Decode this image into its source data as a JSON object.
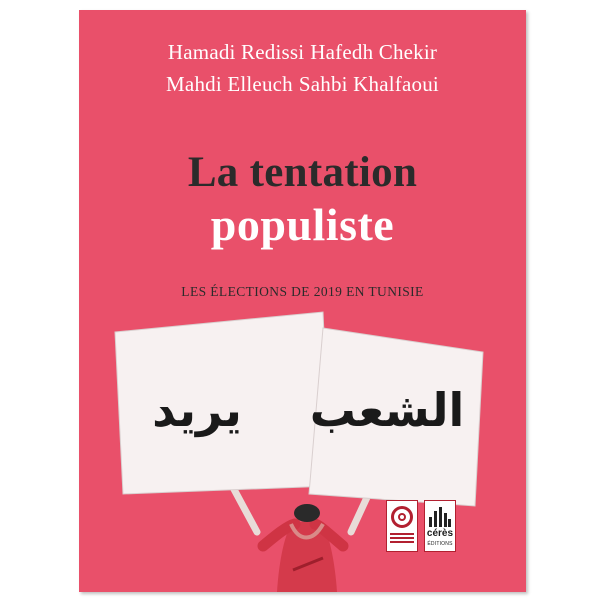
{
  "book": {
    "authors_line_1": [
      "Hamadi Redissi",
      "Hafedh Chekir"
    ],
    "authors_line_2": [
      "Mahdi Elleuch",
      "Sahbi Khalfaoui"
    ],
    "title_line_1": "La tentation",
    "title_line_2": "populiste",
    "subtitle": "LES ÉLECTIONS DE 2019 EN TUNISIE",
    "placard_left_text": "يريد",
    "placard_right_text": "الشعب",
    "publisher_brand": "cérès",
    "publisher_sub": "ÉDITIONS"
  },
  "colors": {
    "cover_background": "#e9506a",
    "title_dark": "#2b2b2b",
    "title_light": "#ffffff",
    "placard": "#f7f1f1",
    "shirt": "#d43a4b",
    "logo_red": "#b22030"
  },
  "icons": {
    "publisher_logo_left": "observatory-logo-icon",
    "publisher_logo_right": "ceres-logo-icon"
  }
}
